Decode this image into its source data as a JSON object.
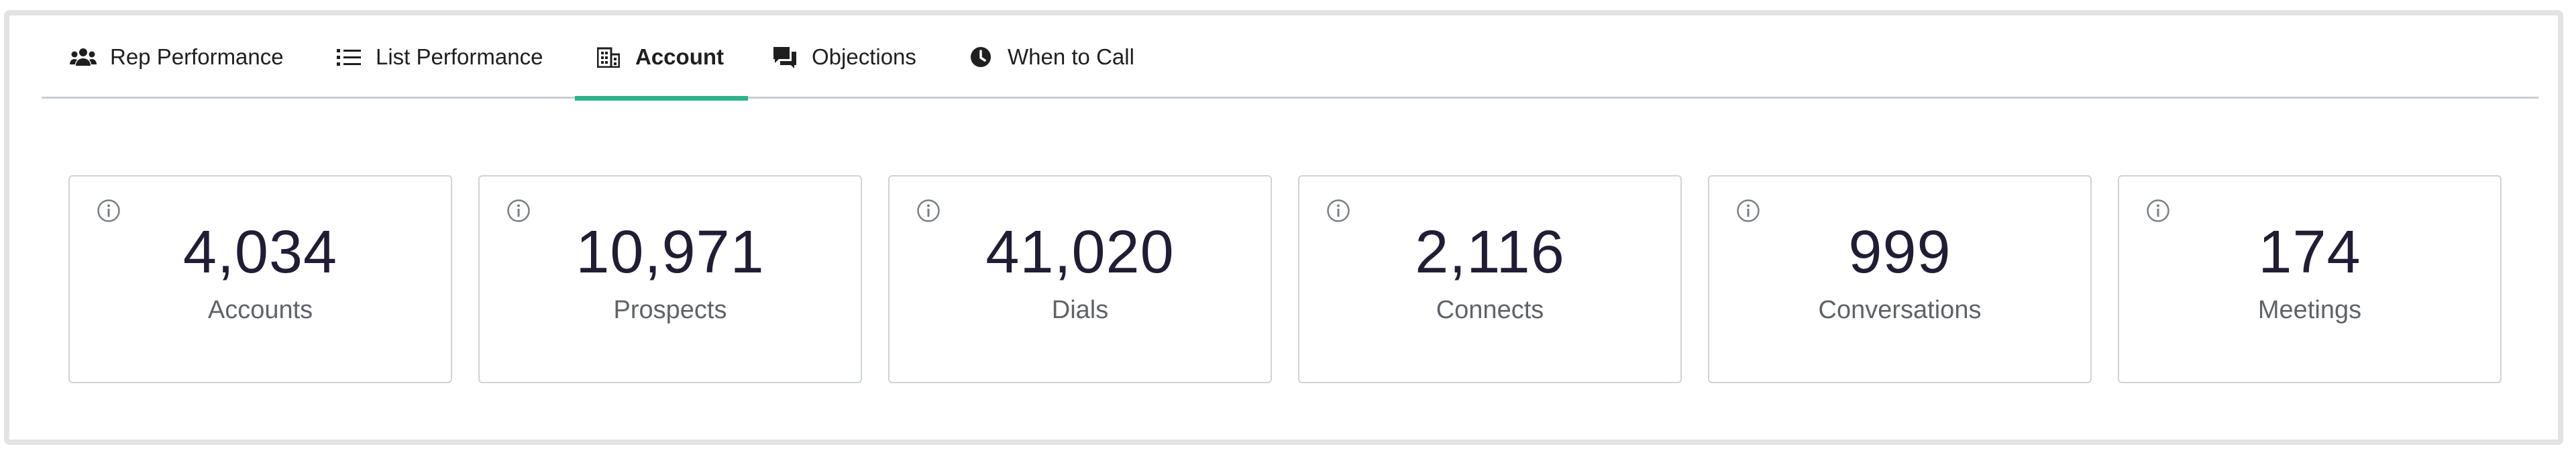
{
  "tabs": [
    {
      "label": "Rep Performance",
      "icon": "users-icon",
      "active": false
    },
    {
      "label": "List Performance",
      "icon": "list-icon",
      "active": false
    },
    {
      "label": "Account",
      "icon": "building-icon",
      "active": true
    },
    {
      "label": "Objections",
      "icon": "chat-icon",
      "active": false
    },
    {
      "label": "When to Call",
      "icon": "clock-icon",
      "active": false
    }
  ],
  "cards": [
    {
      "value": "4,034",
      "label": "Accounts"
    },
    {
      "value": "10,971",
      "label": "Prospects"
    },
    {
      "value": "41,020",
      "label": "Dials"
    },
    {
      "value": "2,116",
      "label": "Connects"
    },
    {
      "value": "999",
      "label": "Conversations"
    },
    {
      "value": "174",
      "label": "Meetings"
    }
  ],
  "colors": {
    "active_tab_underline": "#2fb38a",
    "value_text": "#221c35",
    "label_text": "#5f6368",
    "border": "#cfd3d7"
  }
}
